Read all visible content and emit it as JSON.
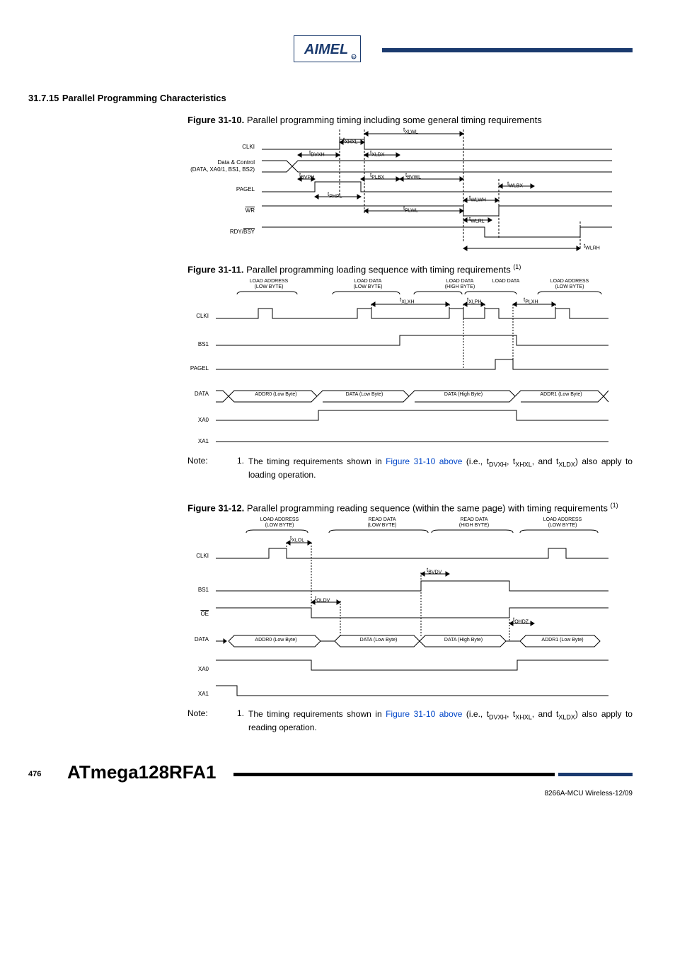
{
  "logo_alt": "Atmel",
  "section": {
    "number": "31.7.15",
    "title": "Parallel Programming Characteristics"
  },
  "fig10": {
    "num": "Figure 31-10.",
    "caption": "Parallel programming timing including some general timing requirements",
    "signals": {
      "clki": "CLKI",
      "data_ctrl_a": "Data & Control",
      "data_ctrl_b": "(DATA, XA0/1, BS1, BS2)",
      "pagel": "PAGEL",
      "wr": "WR",
      "rdy": "RDY/",
      "bsy": "BSY"
    },
    "t": {
      "xlwl": "XLWL",
      "xhxl": "XHXL",
      "dvxh": "DVXH",
      "xldx": "XLDX",
      "bvph": "BVPH",
      "plbx": "PLBX",
      "bvwl": "BVWL",
      "wlbx": "WLBX",
      "phpl": "PHPL",
      "wlwh": "WLWH",
      "plwl": "PLWL",
      "wlrl": "WLRL",
      "wlrh": "WLRH"
    }
  },
  "fig11": {
    "num": "Figure 31-11.",
    "caption": "Parallel programming loading sequence with timing requirements ",
    "cols": {
      "c1a": "LOAD ADDRESS",
      "c1b": "(LOW BYTE)",
      "c2a": "LOAD DATA",
      "c2b": "(LOW BYTE)",
      "c3a": "LOAD DATA",
      "c3b": "(HIGH BYTE)",
      "c4a": "LOAD DATA",
      "c4b": "",
      "c5a": "LOAD ADDRESS",
      "c5b": "(LOW BYTE)"
    },
    "signals": {
      "clki": "CLKI",
      "bs1": "BS1",
      "pagel": "PAGEL",
      "data": "DATA",
      "xa0": "XA0",
      "xa1": "XA1"
    },
    "t": {
      "xlxh": "XLXH",
      "xlph": "XLPH",
      "plxh": "PLXH"
    },
    "data": {
      "d1": "ADDR0 (Low Byte)",
      "d2": "DATA (Low Byte)",
      "d3": "DATA (High Byte)",
      "d4": "ADDR1 (Low Byte)"
    }
  },
  "note1": {
    "label": "Note:",
    "num": "1.",
    "text_a": "The timing requirements shown in ",
    "link": "Figure 31-10 above",
    "text_b": " (i.e., t",
    "s1": "DVXH",
    "text_c": ", t",
    "s2": "XHXL",
    "text_d": ", and t",
    "s3": "XLDX",
    "text_e": ") also apply to loading operation."
  },
  "fig12": {
    "num": "Figure 31-12.",
    "caption": "Parallel programming reading sequence (within the same page) with timing requirements ",
    "cols": {
      "c1a": "LOAD ADDRESS",
      "c1b": "(LOW BYTE)",
      "c2a": "READ DATA",
      "c2b": "(LOW BYTE)",
      "c3a": "READ DATA",
      "c3b": "(HIGH BYTE)",
      "c4a": "LOAD ADDRESS",
      "c4b": "(LOW BYTE)"
    },
    "signals": {
      "clki": "CLKI",
      "bs1": "BS1",
      "oe": "OE",
      "data": "DATA",
      "xa0": "XA0",
      "xa1": "XA1"
    },
    "t": {
      "xlol": "XLOL",
      "bvdv": "BVDV",
      "oldv": "OLDV",
      "ohdz": "OHDZ"
    },
    "data": {
      "d1": "ADDR0 (Low Byte)",
      "d2": "DATA (Low Byte)",
      "d3": "DATA (High Byte)",
      "d4": "ADDR1 (Low Byte)"
    }
  },
  "note2": {
    "label": "Note:",
    "num": "1.",
    "text_a": "The timing requirements shown in ",
    "link": "Figure 31-10 above",
    "text_b": " (i.e., t",
    "s1": "DVXH",
    "text_c": ", t",
    "s2": "XHXL",
    "text_d": ", and t",
    "s3": "XLDX",
    "text_e": ") also apply to reading operation."
  },
  "footer": {
    "page": "476",
    "doc": "ATmega128RFA1",
    "id": "8266A-MCU Wireless-12/09"
  }
}
